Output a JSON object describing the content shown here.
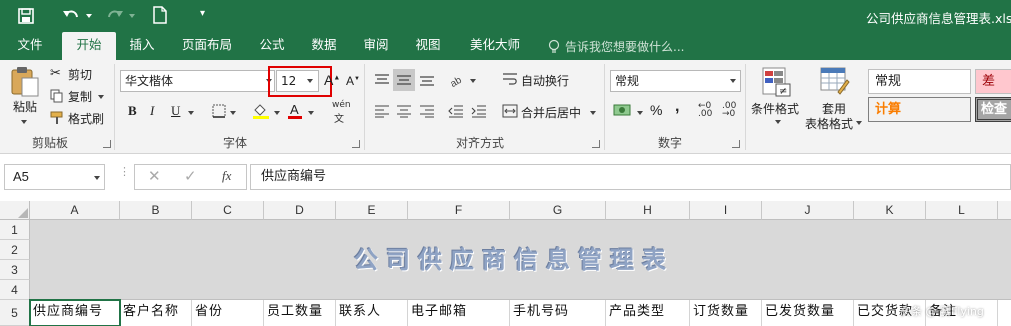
{
  "window": {
    "title": "公司供应商信息管理表.xlsx"
  },
  "qat": {
    "save_icon": "save-icon",
    "undo_icon": "undo-icon",
    "redo_icon": "redo-icon",
    "new_icon": "new-file-icon",
    "customize_icon": "customize-qat-icon"
  },
  "tabs": [
    {
      "label": "文件"
    },
    {
      "label": "开始"
    },
    {
      "label": "插入"
    },
    {
      "label": "页面布局"
    },
    {
      "label": "公式"
    },
    {
      "label": "数据"
    },
    {
      "label": "审阅"
    },
    {
      "label": "视图"
    },
    {
      "label": "美化大师"
    }
  ],
  "tell_me": {
    "placeholder": "告诉我您想要做什么..."
  },
  "ribbon": {
    "clipboard": {
      "paste": "粘贴",
      "cut": "剪切",
      "copy": "复制",
      "format_painter": "格式刷",
      "group": "剪贴板"
    },
    "font": {
      "name": "华文楷体",
      "size": "12",
      "bold": "B",
      "italic": "I",
      "underline": "U",
      "group": "字体",
      "phonetic": "wén"
    },
    "alignment": {
      "wrap": "自动换行",
      "merge": "合并后居中",
      "group": "对齐方式"
    },
    "number": {
      "format": "常规",
      "percent": "%",
      "comma": ",",
      "group": "数字"
    },
    "styles": {
      "conditional": "条件格式",
      "table_label_1": "套用",
      "table_label_2": "表格格式",
      "normal": "常规",
      "bad": "差",
      "calc": "计算",
      "check": "检查"
    }
  },
  "formula_bar": {
    "name_box": "A5",
    "fx": "fx",
    "content": "供应商编号"
  },
  "columns": [
    "A",
    "B",
    "C",
    "D",
    "E",
    "F",
    "G",
    "H",
    "I",
    "J",
    "K",
    "L"
  ],
  "rows": [
    "1",
    "2",
    "3",
    "4",
    "5"
  ],
  "sheet_title": "公司供应商信息管理表",
  "header_row": [
    "供应商编号",
    "客户名称",
    "省份",
    "员工数量",
    "联系人",
    "电子邮箱",
    "手机号码",
    "产品类型",
    "订货数量",
    "已发货数量",
    "已交货款",
    "备注"
  ],
  "watermark": "头条 @ 赛Flying",
  "colors": {
    "excel_green": "#217346",
    "highlight": "#e00000"
  }
}
